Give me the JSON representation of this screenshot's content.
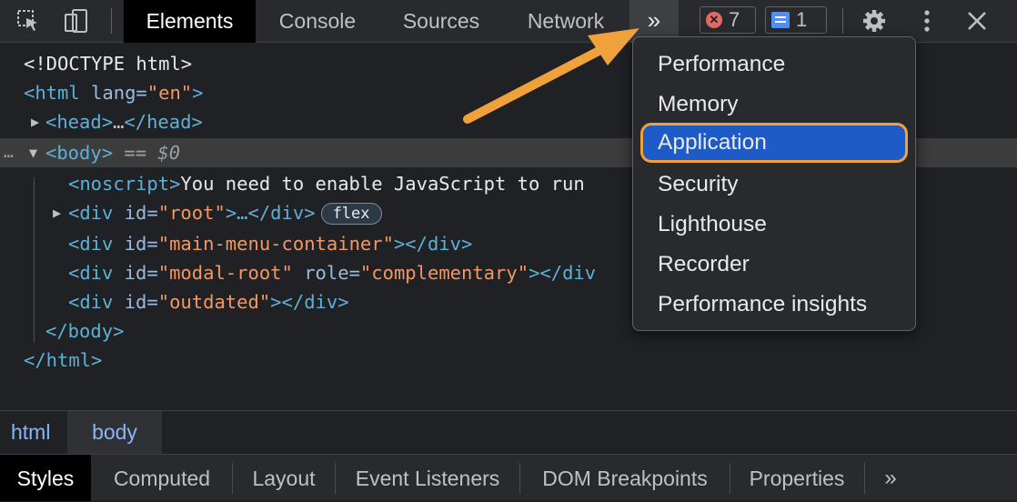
{
  "toolbar": {
    "tabs": [
      "Elements",
      "Console",
      "Sources",
      "Network"
    ],
    "more_tabs_label": "»",
    "errors_count": "7",
    "messages_count": "1",
    "icons": [
      "inspect-icon",
      "device-toolbar-icon",
      "more-tabs-icon",
      "error-icon",
      "message-icon",
      "gear-icon",
      "kebab-menu-icon",
      "close-icon"
    ]
  },
  "dom": {
    "doctype": "<!DOCTYPE html>",
    "html_open_tag": "<html",
    "html_lang_attr": " lang=",
    "html_lang_val": "\"en\"",
    "html_close_bracket": ">",
    "head_open": "<head>",
    "ellipsis": "…",
    "head_close": "</head>",
    "selection_dots": "…",
    "body_open": "<body>",
    "body_eq": " == $0",
    "noscript_open": "<noscript>",
    "noscript_text": "You need to enable JavaScript to run",
    "div_open": "<div",
    "id_attr": " id=",
    "root_val": "\"root\"",
    "root_rest": ">…</div>",
    "flex_badge": "flex",
    "main_menu_val": "\"main-menu-container\"",
    "empty_close": "></div>",
    "modal_root_val": "\"modal-root\"",
    "role_attr": " role=",
    "role_val": "\"complementary\"",
    "modal_close": "></div",
    "outdated_val": "\"outdated\"",
    "body_close": "</body>",
    "html_close": "</html>"
  },
  "breadcrumbs": [
    "html",
    "body"
  ],
  "bottom_tabs": [
    "Styles",
    "Computed",
    "Layout",
    "Event Listeners",
    "DOM Breakpoints",
    "Properties"
  ],
  "bottom_more_label": "»",
  "menu": {
    "items": [
      "Performance",
      "Memory",
      "Application",
      "Security",
      "Lighthouse",
      "Recorder",
      "Performance insights"
    ],
    "highlighted": "Application"
  },
  "colors": {
    "accent_highlight": "#1e5bc6",
    "annotation_arrow": "#f0a13c"
  }
}
